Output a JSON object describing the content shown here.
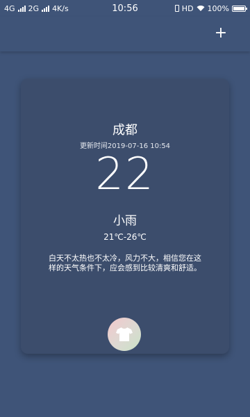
{
  "status_bar": {
    "network_1": "4G",
    "network_2": "2G",
    "speed": "4K/s",
    "time": "10:56",
    "hd": "HD",
    "battery": "100%"
  },
  "toolbar": {
    "add_label": "+"
  },
  "weather_card": {
    "city": "成都",
    "update_time": "更新时间2019-07-16 10:54",
    "temperature": "22",
    "weather": "小雨",
    "temp_range": "21℃-26℃",
    "advice": "白天不太热也不太冷，风力不大，相信您在这样的天气条件下，应会感到比较清爽和舒适。",
    "clothing_icon": "t-shirt-icon"
  },
  "colors": {
    "background": "#3f5478",
    "card": "#3c4d6c",
    "text": "#ffffff"
  }
}
